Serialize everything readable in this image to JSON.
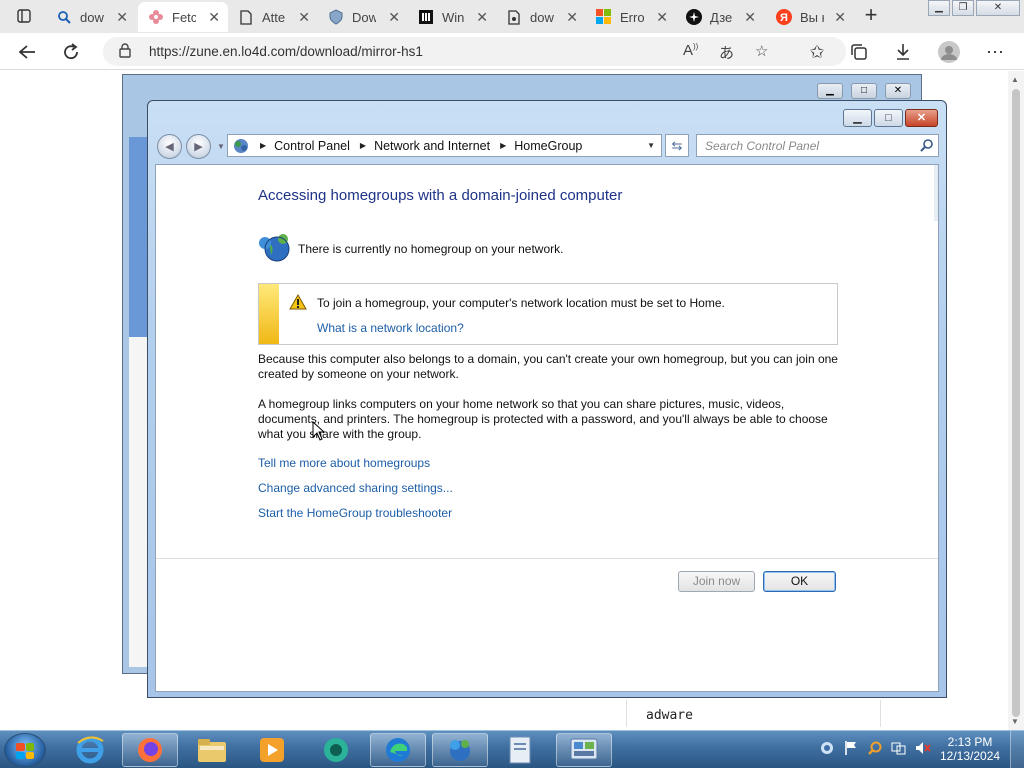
{
  "browser": {
    "tabs": [
      {
        "title": "dow",
        "icon": "search-icon"
      },
      {
        "title": "Fetc",
        "icon": "flower-icon",
        "active": true
      },
      {
        "title": "Atte",
        "icon": "document-icon"
      },
      {
        "title": "Dow",
        "icon": "shield-icon"
      },
      {
        "title": "Win",
        "icon": "book-icon"
      },
      {
        "title": "dow",
        "icon": "download-icon"
      },
      {
        "title": "Erro",
        "icon": "windows-logo-icon"
      },
      {
        "title": "Дзе",
        "icon": "dzen-icon"
      },
      {
        "title": "Вы н",
        "icon": "yandex-icon"
      }
    ],
    "url": "https://zune.en.lo4d.com/download/mirror-hs1"
  },
  "page": {
    "adware_text": "adware"
  },
  "control_panel": {
    "breadcrumb": [
      "Control Panel",
      "Network and Internet",
      "HomeGroup"
    ],
    "search_placeholder": "Search Control Panel",
    "heading": "Accessing homegroups with a domain-joined computer",
    "status": "There is currently no homegroup on your network.",
    "warning": {
      "text": "To join a homegroup, your computer's network location must be set to Home.",
      "link": "What is a network location?"
    },
    "para1": "Because this computer also belongs to a domain, you can't create your own homegroup, but you can join one created by someone on your network.",
    "para2": "A homegroup links computers on your home network so that you can share pictures, music, videos, documents, and printers. The homegroup is protected with a password, and you'll always be able to choose what you share with the group.",
    "links": [
      "Tell me more about homegroups",
      "Change advanced sharing settings...",
      "Start the HomeGroup troubleshooter"
    ],
    "buttons": {
      "join": "Join now",
      "ok": "OK"
    }
  },
  "taskbar": {
    "time": "2:13 PM",
    "date": "12/13/2024"
  }
}
